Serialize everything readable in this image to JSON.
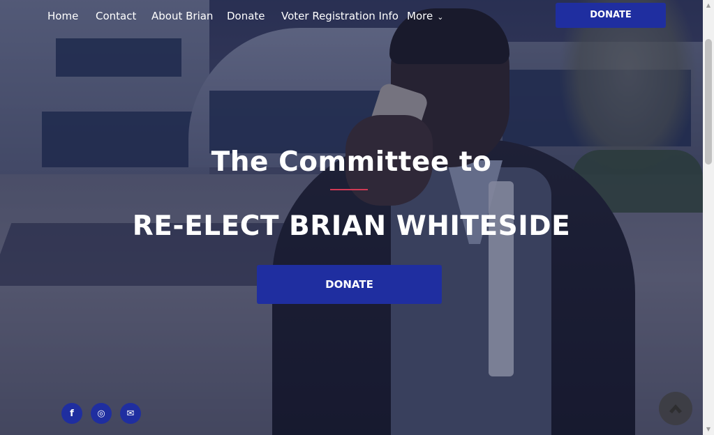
{
  "nav": {
    "items": [
      {
        "label": "Home"
      },
      {
        "label": "Contact"
      },
      {
        "label": "About Brian"
      },
      {
        "label": "Donate"
      },
      {
        "label": "Voter Registration Info"
      },
      {
        "label": "More"
      }
    ],
    "donate_label": "DONATE"
  },
  "hero": {
    "title_line1": "The Committee to",
    "title_line2": "RE-ELECT BRIAN WHITESIDE",
    "donate_label": "DONATE"
  },
  "social": [
    {
      "icon": "facebook-icon",
      "glyph": "f"
    },
    {
      "icon": "instagram-icon",
      "glyph": "◎"
    },
    {
      "icon": "email-icon",
      "glyph": "✉"
    }
  ],
  "colors": {
    "accent": "#1f2ea0",
    "divider": "#d23a55"
  }
}
